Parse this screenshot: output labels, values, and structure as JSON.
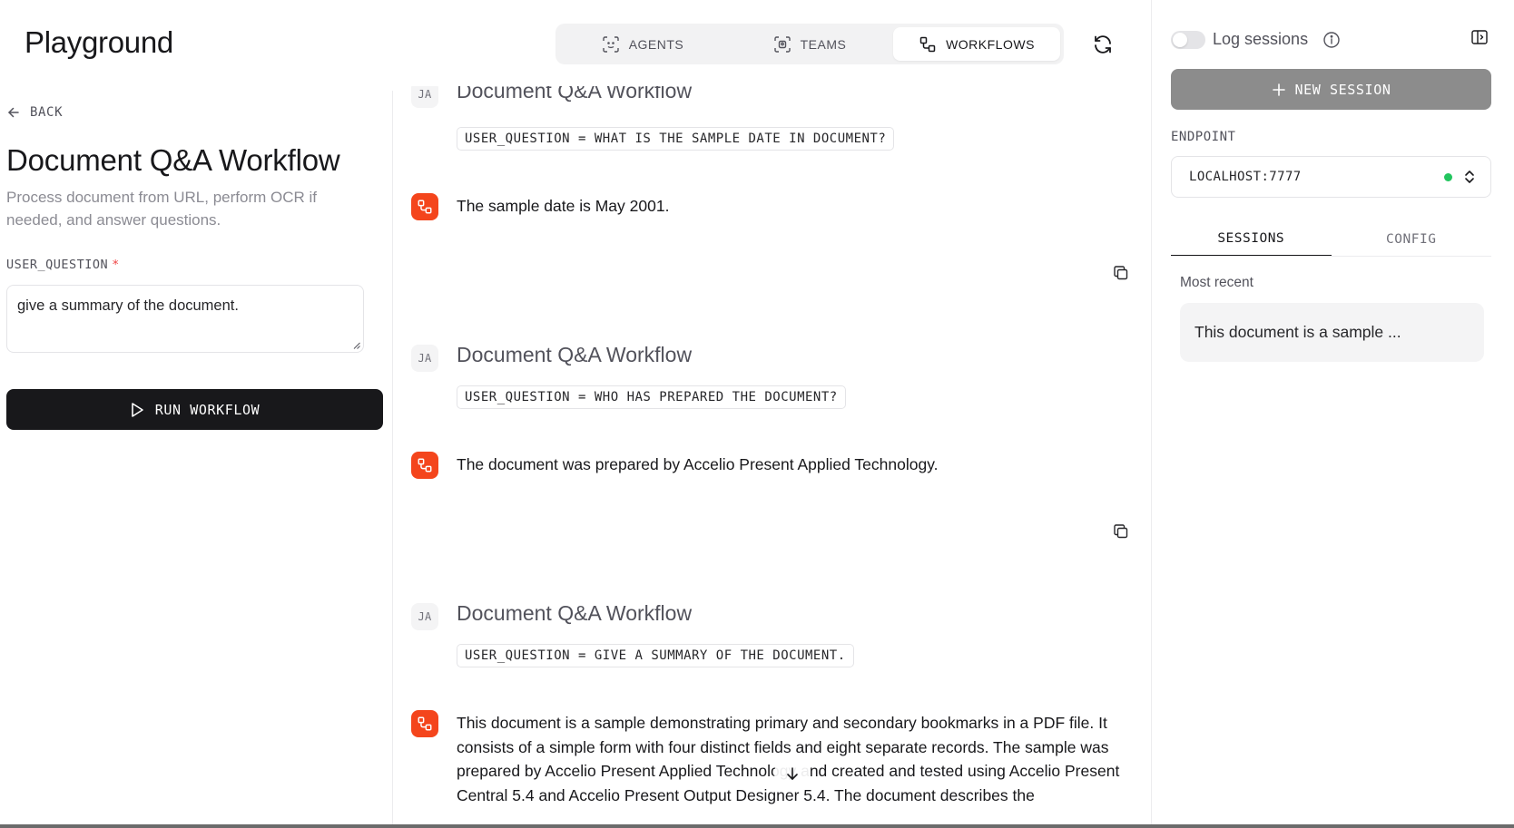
{
  "header": {
    "title": "Playground",
    "mode_tabs": [
      {
        "label": "AGENTS",
        "icon": "agents-icon",
        "active": false
      },
      {
        "label": "TEAMS",
        "icon": "teams-icon",
        "active": false
      },
      {
        "label": "WORKFLOWS",
        "icon": "workflows-icon",
        "active": true
      }
    ],
    "refresh_icon": "refresh-icon"
  },
  "left_panel": {
    "back_label": "BACK",
    "workflow_title": "Document Q&A Workflow",
    "workflow_description": "Process document from URL, perform OCR if needed, and answer questions.",
    "field_label": "USER_QUESTION",
    "field_required_marker": "*",
    "field_value": "give a summary of the document.",
    "run_button_label": "RUN WORKFLOW"
  },
  "chat": {
    "messages": [
      {
        "user_initials": "JA",
        "title": "Document Q&A Workflow",
        "input": "USER_QUESTION = WHAT IS THE SAMPLE DATE IN DOCUMENT?",
        "response": "The sample date is May 2001."
      },
      {
        "user_initials": "JA",
        "title": "Document Q&A Workflow",
        "input": "USER_QUESTION = WHO HAS PREPARED THE DOCUMENT?",
        "response": "The document was prepared by Accelio Present Applied Technology."
      },
      {
        "user_initials": "JA",
        "title": "Document Q&A Workflow",
        "input": "USER_QUESTION = GIVE A SUMMARY OF THE DOCUMENT.",
        "response": "This document is a sample demonstrating primary and secondary bookmarks in a PDF file. It consists of a simple form with four distinct fields and eight separate records. The sample was prepared by Accelio Present Applied Technology and created and tested using Accelio Present Central 5.4 and Accelio Present Output Designer 5.4. The document describes the"
      }
    ]
  },
  "sidebar": {
    "log_sessions_label": "Log sessions",
    "log_sessions_enabled": false,
    "new_session_label": "NEW SESSION",
    "endpoint_label": "ENDPOINT",
    "endpoint_value": "LOCALHOST:7777",
    "endpoint_status_color": "#22c55e",
    "tabs": [
      {
        "label": "SESSIONS",
        "active": true
      },
      {
        "label": "CONFIG",
        "active": false
      }
    ],
    "recent_label": "Most recent",
    "sessions": [
      {
        "preview": "This document is a sample ..."
      }
    ]
  },
  "colors": {
    "accent": "#f4451c",
    "run_button_bg": "#18181b",
    "new_session_bg": "#8c8c8c"
  }
}
